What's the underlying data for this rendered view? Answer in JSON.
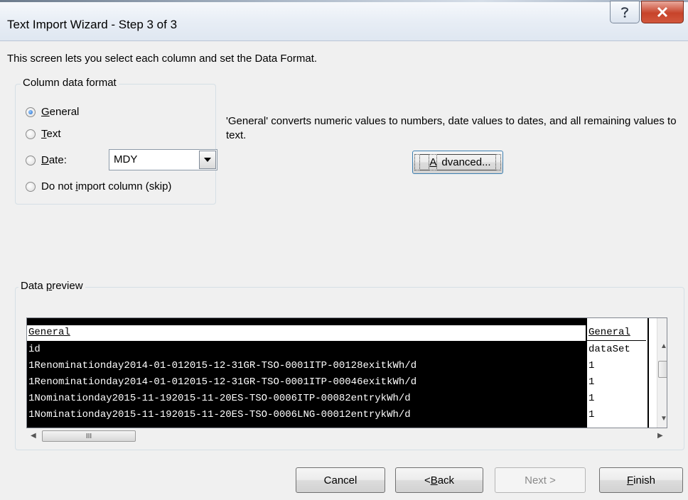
{
  "window": {
    "title": "Text Import Wizard - Step 3 of 3",
    "help_icon": "question-icon",
    "close_icon": "close-x-icon"
  },
  "description": "This screen lets you select each column and set the Data Format.",
  "column_format": {
    "legend": "Column data format",
    "options": [
      {
        "pre": "",
        "key": "G",
        "post": "eneral",
        "selected": true
      },
      {
        "pre": "",
        "key": "T",
        "post": "ext",
        "selected": false
      },
      {
        "pre": "",
        "key": "D",
        "post": "ate:",
        "selected": false
      },
      {
        "pre": "Do not ",
        "key": "i",
        "post": "mport column (skip)",
        "selected": false
      }
    ],
    "date_value": "MDY"
  },
  "explanation": "'General' converts numeric values to numbers, date values to dates, and all remaining values to text.",
  "advanced_button": {
    "pre": "",
    "key": "A",
    "post": "dvanced..."
  },
  "preview": {
    "legend_pre": "Data ",
    "legend_key": "p",
    "legend_post": "review",
    "headers": [
      "General",
      "General"
    ],
    "rows": [
      [
        "id",
        "dataSet"
      ],
      [
        "1Renominationday2014-01-012015-12-31GR-TSO-0001ITP-00128exitkWh/d",
        "1"
      ],
      [
        "1Renominationday2014-01-012015-12-31GR-TSO-0001ITP-00046exitkWh/d",
        "1"
      ],
      [
        "1Nominationday2015-11-192015-11-20ES-TSO-0006ITP-00082entrykWh/d",
        "1"
      ],
      [
        "1Nominationday2015-11-192015-11-20ES-TSO-0006LNG-00012entrykWh/d",
        "1"
      ]
    ],
    "hscroll_thumb_glyph": "III"
  },
  "buttons": {
    "cancel": "Cancel",
    "back_pre": "< ",
    "back_key": "B",
    "back_post": "ack",
    "next": "Next >",
    "finish_key": "F",
    "finish_post": "inish"
  }
}
